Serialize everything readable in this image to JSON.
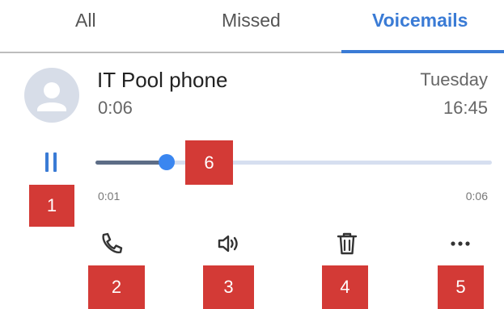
{
  "tabs": [
    {
      "label": "All",
      "active": false
    },
    {
      "label": "Missed",
      "active": false
    },
    {
      "label": "Voicemails",
      "active": true
    }
  ],
  "voicemail": {
    "caller": "IT Pool phone",
    "duration": "0:06",
    "day": "Tuesday",
    "time": "16:45"
  },
  "player": {
    "state_icon": "pause-icon",
    "elapsed": "0:01",
    "total": "0:06",
    "progress": 0.18
  },
  "actions": [
    {
      "name": "call-back",
      "icon": "phone-icon"
    },
    {
      "name": "speaker",
      "icon": "speaker-icon"
    },
    {
      "name": "delete",
      "icon": "trash-icon"
    },
    {
      "name": "more",
      "icon": "more-icon"
    }
  ],
  "markers": [
    "1",
    "2",
    "3",
    "4",
    "5",
    "6"
  ],
  "colors": {
    "accent": "#3a7bd5",
    "marker": "#d33a36",
    "track": "#d6dff0",
    "track_fill": "#5d6d86"
  }
}
